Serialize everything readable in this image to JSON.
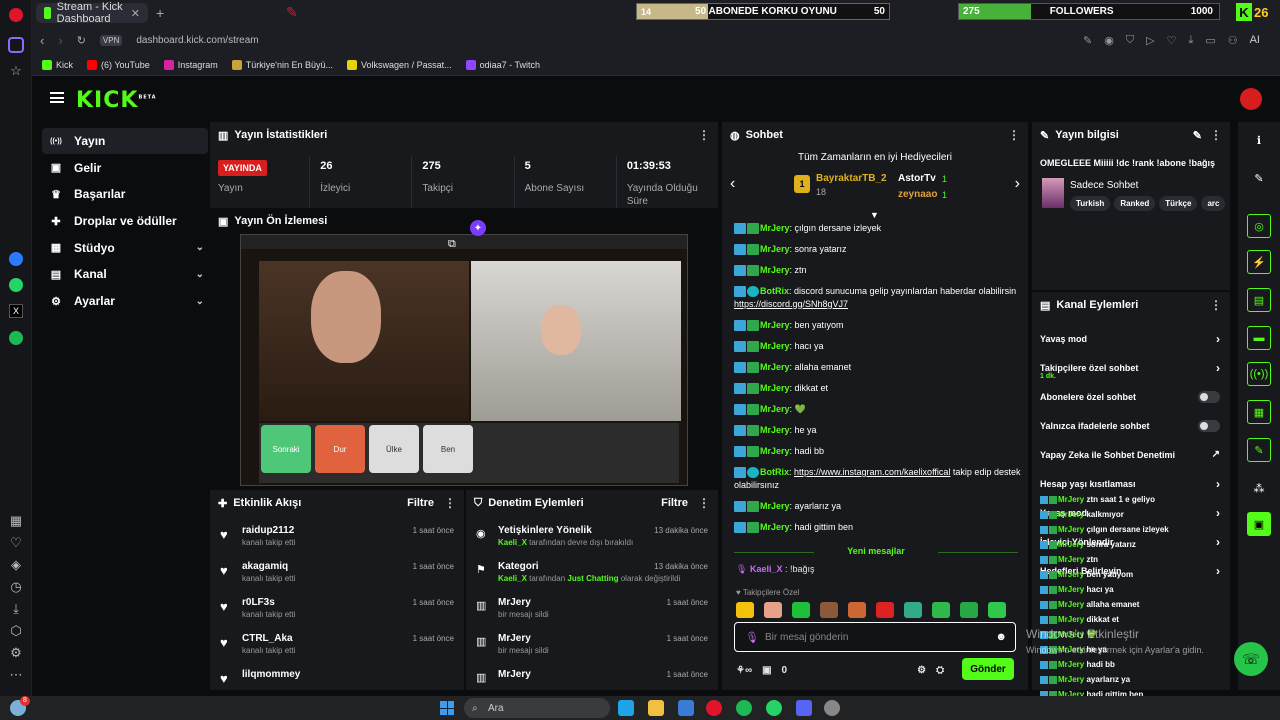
{
  "browser": {
    "tab_title": "Stream - Kick Dashboard",
    "url": "dashboard.kick.com/stream",
    "vpn": "VPN",
    "ai_label": "AI",
    "bookmarks": [
      "Kick",
      "(6) YouTube",
      "Instagram",
      "Türkiye'nin En Büyü...",
      "Volkswagen / Passat...",
      "odiaa7 - Twitch"
    ]
  },
  "overlays": {
    "sub_goal": {
      "current": "14",
      "label": "50 ABONEDE KORKU OYUNU",
      "target": "50",
      "progress": 0.28
    },
    "followers_goal": {
      "current": "275",
      "label": "FOLLOWERS",
      "target": "1000",
      "progress": 0.275
    },
    "kick_count": "26"
  },
  "nav": {
    "logo": "KICK",
    "logo_sup": "BETA",
    "items": [
      {
        "label": "Yayın",
        "icon": "broadcast-icon",
        "active": true
      },
      {
        "label": "Gelir",
        "icon": "revenue-icon"
      },
      {
        "label": "Başarılar",
        "icon": "trophy-icon"
      },
      {
        "label": "Droplar ve ödüller",
        "icon": "gift-icon"
      },
      {
        "label": "Stüdyo",
        "icon": "studio-icon",
        "expand": true
      },
      {
        "label": "Kanal",
        "icon": "channel-icon",
        "expand": true
      },
      {
        "label": "Ayarlar",
        "icon": "settings-icon",
        "expand": true
      }
    ]
  },
  "stats": {
    "title": "Yayın İstatistikleri",
    "live_badge": "YAYINDA",
    "items": [
      {
        "value": "",
        "label": "Yayın"
      },
      {
        "value": "26",
        "label": "İzleyici"
      },
      {
        "value": "275",
        "label": "Takipçi"
      },
      {
        "value": "5",
        "label": "Abone Sayısı"
      },
      {
        "value": "01:39:53",
        "label": "Yayında Olduğu Süre"
      }
    ]
  },
  "preview": {
    "title": "Yayın Ön İzlemesi",
    "buttons": [
      "Sonraki",
      "Dur",
      "Ülke",
      "Ben"
    ]
  },
  "activity": {
    "title": "Etkinlik Akışı",
    "filter": "Filtre",
    "items": [
      {
        "user": "raidup2112",
        "action": "kanalı takip etti",
        "time": "1 saat önce"
      },
      {
        "user": "akagamiq",
        "action": "kanalı takip etti",
        "time": "1 saat önce"
      },
      {
        "user": "r0LF3s",
        "action": "kanalı takip etti",
        "time": "1 saat önce"
      },
      {
        "user": "CTRL_Aka",
        "action": "kanalı takip etti",
        "time": "1 saat önce"
      },
      {
        "user": "lilqmommey",
        "action": "",
        "time": ""
      }
    ]
  },
  "moderation": {
    "title": "Denetim Eylemleri",
    "filter": "Filtre",
    "items": [
      {
        "title": "Yetişkinlere Yönelik",
        "actor": "Kaeli_X",
        "desc": " tarafından devre dışı bırakıldı",
        "time": "13 dakika önce"
      },
      {
        "title": "Kategori",
        "actor": "Kaeli_X",
        "desc": " tarafından ",
        "extra": "Just Chatting",
        "desc2": " olarak değiştirildi",
        "time": "13 dakika önce"
      },
      {
        "title": "MrJery",
        "desc": "bir mesajı sildi",
        "time": "1 saat önce"
      },
      {
        "title": "MrJery",
        "desc": "bir mesajı sildi",
        "time": "1 saat önce"
      },
      {
        "title": "MrJery",
        "desc": "",
        "time": "1 saat önce"
      }
    ]
  },
  "chat": {
    "title": "Sohbet",
    "gifters_title": "Tüm Zamanların en iyi Hediyecileri",
    "gifters": [
      {
        "rank": "1",
        "name": "BayraktarTB_2",
        "count": "18"
      },
      {
        "name": "AstorTv",
        "count": "1"
      },
      {
        "name": "zeynaao",
        "count": "1"
      }
    ],
    "messages": [
      {
        "user": "MrJery",
        "text": ": çılgın dersane izleyek"
      },
      {
        "user": "MrJery",
        "text": ": sonra yatarız"
      },
      {
        "user": "MrJery",
        "text": ": ztn"
      },
      {
        "user": "BotRix",
        "text": ": discord sunucuma gelip yayınlardan haberdar olabilirsin ",
        "link": "https://discord.gg/SNh8gVJ7"
      },
      {
        "user": "MrJery",
        "text": ": ben yatıyom"
      },
      {
        "user": "MrJery",
        "text": ": hacı ya"
      },
      {
        "user": "MrJery",
        "text": ": allaha emanet"
      },
      {
        "user": "MrJery",
        "text": ": dikkat et"
      },
      {
        "user": "MrJery",
        "text": ": 💚"
      },
      {
        "user": "MrJery",
        "text": ": he ya"
      },
      {
        "user": "MrJery",
        "text": ": hadi bb"
      },
      {
        "user": "BotRix",
        "text": ": ",
        "link": "https://www.instagram.com/kaelixoffical",
        "after": " takip edip destek olabilirsınız"
      },
      {
        "user": "MrJery",
        "text": ": ayarlarız ya"
      },
      {
        "user": "MrJery",
        "text": ": hadi gittim ben"
      }
    ],
    "new_messages": "Yeni mesajlar",
    "kaeli": {
      "user": "Kaeli_X",
      "text": ": !bağış"
    },
    "followers_only": "Takipçilere Özel",
    "input_placeholder": "Bir mesaj gönderin",
    "points": "0",
    "send": "Gönder"
  },
  "streaminfo": {
    "title": "Yayın bilgisi",
    "stream_title": "OMEGLEEE Miiiii !dc !rank !abone !bağış",
    "category": "Sadece Sohbet",
    "tags": [
      "Turkish",
      "Ranked",
      "Türkçe",
      "arc"
    ]
  },
  "channel_actions": {
    "title": "Kanal Eylemleri",
    "items": [
      {
        "label": "Yavaş mod",
        "type": "arrow"
      },
      {
        "label": "Takipçilere özel sohbet",
        "type": "arrow",
        "sub": "1 dk."
      },
      {
        "label": "Abonelere özel sohbet",
        "type": "toggle"
      },
      {
        "label": "Yalnızca ifadelerle sohbet",
        "type": "toggle"
      },
      {
        "label": "Yapay Zeka ile Sohbet Denetimi",
        "type": "external"
      },
      {
        "label": "Hesap yaşı kısıtlaması",
        "type": "arrow"
      },
      {
        "label": "Yavaş mod",
        "type": "arrow"
      },
      {
        "label": "İzleyici Yönlendir",
        "type": "arrow"
      },
      {
        "label": "Hedefleri Belirleyin",
        "type": "arrow"
      }
    ]
  },
  "popout_chat": [
    {
      "user": "MrJery",
      "text": "ztn saat 1 e geliyo"
    },
    {
      "user": "MrJery",
      "text": "kalkmıyor"
    },
    {
      "user": "MrJery",
      "text": "çılgın dersane izleyek"
    },
    {
      "user": "MrJery",
      "text": "sonra yatarız"
    },
    {
      "user": "MrJery",
      "text": "ztn"
    },
    {
      "user": "MrJery",
      "text": "ben yatıyom"
    },
    {
      "user": "MrJery",
      "text": "hacı ya"
    },
    {
      "user": "MrJery",
      "text": "allaha emanet"
    },
    {
      "user": "MrJery",
      "text": "dikkat et"
    },
    {
      "user": "MrJery",
      "text": "💚"
    },
    {
      "user": "MrJery",
      "text": "he ya"
    },
    {
      "user": "MrJery",
      "text": "hadi bb"
    },
    {
      "user": "MrJery",
      "text": "ayarlarız ya"
    },
    {
      "user": "MrJery",
      "text": "hadi gittim ben"
    },
    {
      "user": "Kaeli_X",
      "text": "!bağış"
    }
  ],
  "watermark": {
    "line1": "Windows'u Etkinleştir",
    "line2": "Windows'u etkinleştirmek için Ayarlar'a gidin."
  },
  "taskbar": {
    "search": "Ara",
    "notif_count": "8"
  }
}
